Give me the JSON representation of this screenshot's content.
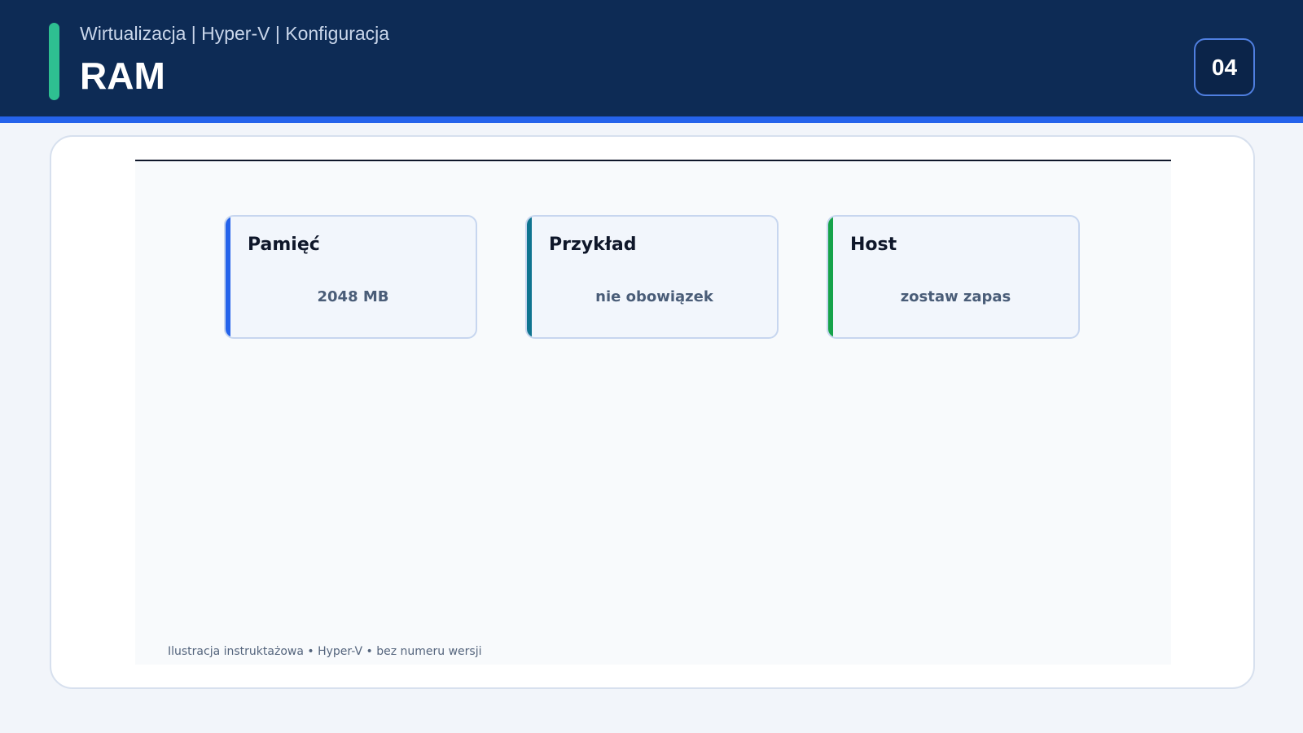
{
  "header": {
    "breadcrumb": "Wirtualizacja | Hyper-V | Konfiguracja",
    "title": "RAM",
    "page_number": "04"
  },
  "cards": [
    {
      "title": "Pamięć",
      "value": "2048 MB",
      "accent": "#2563eb"
    },
    {
      "title": "Przykład",
      "value": "nie obowiązek",
      "accent": "#0f7490"
    },
    {
      "title": "Host",
      "value": "zostaw zapas",
      "accent": "#16a34a"
    }
  ],
  "caption": "Ilustracja instruktażowa • Hyper-V • bez numeru wersji",
  "colors": {
    "header_bg": "#0d2b55",
    "header_stripe": "#2563eb",
    "accent_bar": "#2ebf91"
  }
}
